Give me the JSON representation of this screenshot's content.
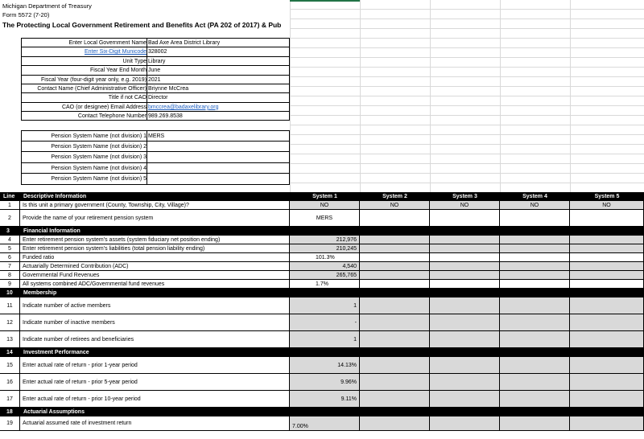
{
  "header": {
    "dept": "Michigan Department of Treasury",
    "form": "Form 5572 (7-20)",
    "title": "The Protecting Local Government Retirement and Benefits Act (PA 202 of 2017)  & Pub"
  },
  "info": [
    {
      "label": "Enter Local Government Name",
      "value": "Bad Axe Area District Library",
      "label_link": false,
      "value_link": false
    },
    {
      "label": "Enter Six-Digit Municode",
      "value": "328002",
      "label_link": true,
      "value_link": false
    },
    {
      "label": "Unit Type",
      "value": "Library",
      "label_link": false,
      "value_link": false
    },
    {
      "label": "Fiscal Year End Month",
      "value": "June",
      "label_link": false,
      "value_link": false
    },
    {
      "label": "Fiscal Year (four-digit year only, e.g. 2019)",
      "value": "2021",
      "label_link": false,
      "value_link": false
    },
    {
      "label": "Contact Name (Chief Administrative Officer)",
      "value": "Briynne McCrea",
      "label_link": false,
      "value_link": false
    },
    {
      "label": "Title if not CAO",
      "value": "Director",
      "label_link": false,
      "value_link": false
    },
    {
      "label": "CAO (or designee) Email Address",
      "value": "bmccrea@badaxelibrary.org",
      "label_link": false,
      "value_link": true
    },
    {
      "label": "Contact Telephone Number",
      "value": "989.269.8538",
      "label_link": false,
      "value_link": false
    }
  ],
  "pension": [
    {
      "label": "Pension System Name (not division) 1",
      "value": "MERS"
    },
    {
      "label": "Pension System Name (not division) 2",
      "value": ""
    },
    {
      "label": "Pension System Name (not division) 3",
      "value": ""
    },
    {
      "label": "Pension System Name (not division) 4",
      "value": ""
    },
    {
      "label": "Pension System Name (not division) 5",
      "value": ""
    }
  ],
  "table": {
    "head": {
      "line": "Line",
      "desc": "Descriptive Information",
      "systems": [
        "System 1",
        "System 2",
        "System 3",
        "System 4",
        "System 5"
      ]
    },
    "rows": [
      {
        "n": "1",
        "d": "Is this unit a primary government (County, Township, City, Village)?",
        "v": [
          "NO",
          "NO",
          "NO",
          "NO",
          "NO"
        ],
        "kind": "gray",
        "h": 11,
        "align": "center"
      },
      {
        "n": "2",
        "d": "Provide the name of your retirement pension system",
        "v": [
          "MERS",
          "",
          "",
          "",
          ""
        ],
        "kind": "white",
        "h": 21,
        "align": "center"
      },
      {
        "n": "3",
        "d": "Financial Information",
        "v": [
          "",
          "",
          "",
          "",
          ""
        ],
        "kind": "sec",
        "h": 11,
        "align": "center"
      },
      {
        "n": "4",
        "d": "Enter retirement pension system's assets (system fiduciary net position ending)",
        "v": [
          "212,976",
          "",
          "",
          "",
          ""
        ],
        "kind": "gray",
        "h": 11,
        "align": "right"
      },
      {
        "n": "5",
        "d": "Enter retirement pension system's liabilities (total pension liability ending)",
        "v": [
          "210,245",
          "",
          "",
          "",
          ""
        ],
        "kind": "gray",
        "h": 11,
        "align": "right"
      },
      {
        "n": "6",
        "d": "Funded ratio",
        "v": [
          "101.3%",
          "",
          "",
          "",
          ""
        ],
        "kind": "white",
        "h": 11,
        "align": "mid"
      },
      {
        "n": "7",
        "d": "Actuarially Determined Contribution (ADC)",
        "v": [
          "4,540",
          "",
          "",
          "",
          ""
        ],
        "kind": "gray",
        "h": 11,
        "align": "right"
      },
      {
        "n": "8",
        "d": "Governmental Fund Revenues",
        "v": [
          "265,765",
          "",
          "",
          "",
          ""
        ],
        "kind": "gray",
        "h": 11,
        "align": "right"
      },
      {
        "n": "9",
        "d": "All systems combined ADC/Governmental fund revenues",
        "v": [
          "1.7%",
          "",
          "",
          "",
          ""
        ],
        "kind": "white",
        "h": 11,
        "align": "mid"
      },
      {
        "n": "10",
        "d": "Membership",
        "v": [
          "",
          "",
          "",
          "",
          ""
        ],
        "kind": "sec",
        "h": 11,
        "align": "center"
      },
      {
        "n": "11",
        "d": "Indicate number of active members",
        "v": [
          "1",
          "",
          "",
          "",
          ""
        ],
        "kind": "gray",
        "h": 21,
        "align": "right"
      },
      {
        "n": "12",
        "d": "Indicate number of inactive members",
        "v": [
          "-",
          "",
          "",
          "",
          ""
        ],
        "kind": "gray",
        "h": 21,
        "align": "right"
      },
      {
        "n": "13",
        "d": "Indicate number of retirees and beneficiaries",
        "v": [
          "1",
          "",
          "",
          "",
          ""
        ],
        "kind": "gray",
        "h": 21,
        "align": "right"
      },
      {
        "n": "14",
        "d": "Investment Performance",
        "v": [
          "",
          "",
          "",
          "",
          ""
        ],
        "kind": "sec",
        "h": 11,
        "align": "center"
      },
      {
        "n": "15",
        "d": "Enter actual rate of return - prior 1-year period",
        "v": [
          "14.13%",
          "",
          "",
          "",
          ""
        ],
        "kind": "gray",
        "h": 21,
        "align": "right"
      },
      {
        "n": "16",
        "d": "Enter actual rate of return - prior 5-year period",
        "v": [
          "9.96%",
          "",
          "",
          "",
          ""
        ],
        "kind": "gray",
        "h": 21,
        "align": "right"
      },
      {
        "n": "17",
        "d": "Enter actual rate of return - prior 10-year period",
        "v": [
          "9.11%",
          "",
          "",
          "",
          ""
        ],
        "kind": "gray",
        "h": 21,
        "align": "right"
      },
      {
        "n": "18",
        "d": "Actuarial Assumptions",
        "v": [
          "",
          "",
          "",
          "",
          ""
        ],
        "kind": "sec",
        "h": 11,
        "align": "center"
      },
      {
        "n": "19",
        "d": "Actuarial assumed rate of investment return",
        "v": [
          "7.00%",
          "",
          "",
          "",
          ""
        ],
        "kind": "gray",
        "h": 18,
        "align": "left"
      }
    ]
  },
  "colors": {
    "section": "#000000",
    "input_gray": "#d9d9d9",
    "link": "#1f5fbf"
  }
}
